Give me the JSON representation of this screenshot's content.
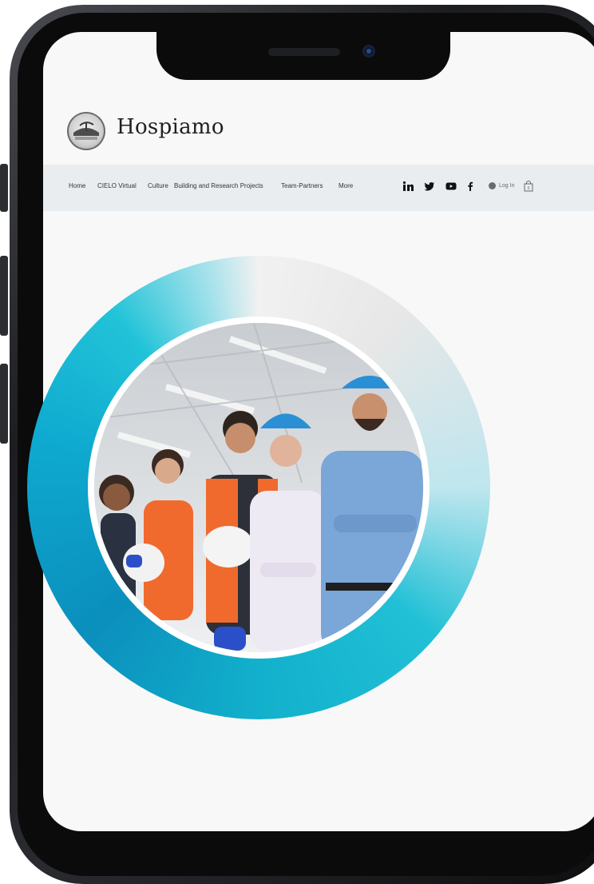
{
  "site": {
    "brand": "Hospiamo",
    "logo_icon": "hospiamo-logo-icon"
  },
  "nav": {
    "items": [
      {
        "label": "Home"
      },
      {
        "label": "CIELO Virtual"
      },
      {
        "label": "Culture"
      },
      {
        "label": "Building and Research Projects"
      },
      {
        "label": "Team-Partners"
      },
      {
        "label": "More"
      }
    ],
    "social": [
      {
        "name": "linkedin-icon",
        "glyph": "in"
      },
      {
        "name": "twitter-icon",
        "glyph": "t"
      },
      {
        "name": "youtube-icon",
        "glyph": "▶"
      },
      {
        "name": "facebook-icon",
        "glyph": "f"
      }
    ],
    "login_label": "Log In",
    "cart_count": "0"
  },
  "hero": {
    "image": "team-of-workers-photo",
    "colors": {
      "ring_dark": "#0b8fbd",
      "ring_light": "#21c3d8",
      "ring_fade": "#f1f1f1"
    }
  }
}
